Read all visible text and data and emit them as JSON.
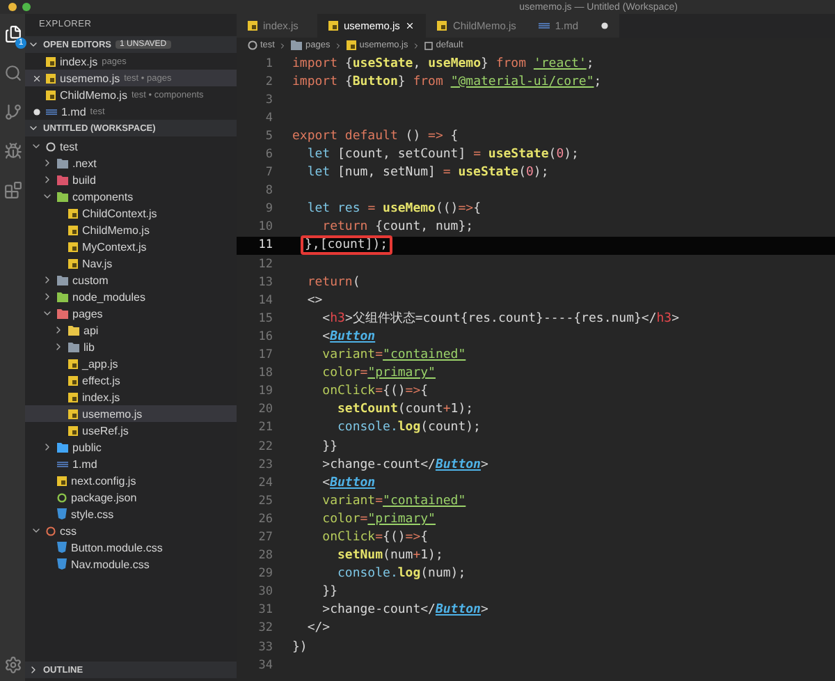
{
  "window": {
    "title": "usememo.js — Untitled (Workspace)"
  },
  "activity_bar": [
    {
      "kind": "explorer",
      "selected": true,
      "badge": "1"
    },
    {
      "kind": "search",
      "selected": false
    },
    {
      "kind": "source-control",
      "selected": false
    },
    {
      "kind": "debug",
      "selected": false
    },
    {
      "kind": "extensions",
      "selected": false
    },
    {
      "kind": "settings",
      "selected": false
    }
  ],
  "sidebar": {
    "title": "EXPLORER",
    "open_editors": {
      "title": "OPEN EDITORS",
      "badge": "1 UNSAVED",
      "expanded": true,
      "items": [
        {
          "name": "index.js",
          "description": "pages",
          "kind": "js",
          "selected": false,
          "modified": false
        },
        {
          "name": "usememo.js",
          "description": "test • pages",
          "kind": "js",
          "selected": true,
          "modified": false
        },
        {
          "name": "ChildMemo.js",
          "description": "test • components",
          "kind": "js",
          "selected": false,
          "modified": false
        },
        {
          "name": "1.md",
          "description": "test",
          "kind": "md",
          "selected": false,
          "modified": true
        }
      ]
    },
    "workspace": {
      "title": "UNTITLED (WORKSPACE)",
      "expanded": true,
      "tree": [
        {
          "name": "test",
          "kind": "root",
          "color": "#c8c8c8",
          "expanded": true,
          "children": [
            {
              "name": ".next",
              "kind": "folder",
              "color": "#8d9aa8",
              "expanded": false
            },
            {
              "name": "build",
              "kind": "folder",
              "color": "#d9536a",
              "expanded": false
            },
            {
              "name": "components",
              "kind": "folder",
              "color": "#8bc34a",
              "expanded": true,
              "children": [
                {
                  "name": "ChildContext.js",
                  "kind": "js",
                  "selected": false
                },
                {
                  "name": "ChildMemo.js",
                  "kind": "js",
                  "selected": false
                },
                {
                  "name": "MyContext.js",
                  "kind": "js",
                  "selected": false
                },
                {
                  "name": "Nav.js",
                  "kind": "js",
                  "selected": false
                }
              ]
            },
            {
              "name": "custom",
              "kind": "folder",
              "color": "#8d9aa8",
              "expanded": false
            },
            {
              "name": "node_modules",
              "kind": "folder",
              "color": "#8bc34a",
              "expanded": false
            },
            {
              "name": "pages",
              "kind": "folder",
              "color": "#e26a6a",
              "expanded": true,
              "children": [
                {
                  "name": "api",
                  "kind": "folder",
                  "color": "#e8c547",
                  "expanded": false
                },
                {
                  "name": "lib",
                  "kind": "folder",
                  "color": "#8d9aa8",
                  "expanded": false
                },
                {
                  "name": "_app.js",
                  "kind": "js",
                  "selected": false
                },
                {
                  "name": "effect.js",
                  "kind": "js",
                  "selected": false
                },
                {
                  "name": "index.js",
                  "kind": "js",
                  "selected": false
                },
                {
                  "name": "usememo.js",
                  "kind": "js",
                  "selected": true
                },
                {
                  "name": "useRef.js",
                  "kind": "js",
                  "selected": false
                }
              ]
            },
            {
              "name": "public",
              "kind": "folder",
              "color": "#42a5f5",
              "expanded": false
            },
            {
              "name": "1.md",
              "kind": "md",
              "selected": false
            },
            {
              "name": "next.config.js",
              "kind": "js",
              "selected": false
            },
            {
              "name": "package.json",
              "kind": "json",
              "selected": false
            },
            {
              "name": "style.css",
              "kind": "css",
              "selected": false
            }
          ]
        },
        {
          "name": "css",
          "kind": "root",
          "color": "#e07050",
          "expanded": true,
          "children": [
            {
              "name": "Button.module.css",
              "kind": "css",
              "selected": false
            },
            {
              "name": "Nav.module.css",
              "kind": "css",
              "selected": false
            }
          ]
        }
      ]
    },
    "outline": {
      "title": "OUTLINE",
      "expanded": false
    }
  },
  "tabs": [
    {
      "label": "index.js",
      "kind": "js",
      "selected": false,
      "modified": false
    },
    {
      "label": "usememo.js",
      "kind": "js",
      "selected": true,
      "modified": false
    },
    {
      "label": "ChildMemo.js",
      "kind": "js",
      "selected": false,
      "modified": false
    },
    {
      "label": "1.md",
      "kind": "md",
      "selected": false,
      "modified": true
    }
  ],
  "breadcrumb": [
    {
      "label": "test",
      "kind": "root"
    },
    {
      "label": "pages",
      "kind": "folder"
    },
    {
      "label": "usememo.js",
      "kind": "js"
    },
    {
      "label": "default",
      "kind": "symbol"
    }
  ],
  "code": [
    {
      "number": "1",
      "tokens": [
        {
          "kind": "kw",
          "text": "import "
        },
        {
          "kind": "plain",
          "text": "{"
        },
        {
          "kind": "fn",
          "text": "useState"
        },
        {
          "kind": "plain",
          "text": ", "
        },
        {
          "kind": "fn",
          "text": "useMemo"
        },
        {
          "kind": "plain",
          "text": "} "
        },
        {
          "kind": "kw",
          "text": "from "
        },
        {
          "kind": "str",
          "text": "'react'"
        },
        {
          "kind": "plain",
          "text": ";"
        }
      ]
    },
    {
      "number": "2",
      "tokens": [
        {
          "kind": "kw",
          "text": "import "
        },
        {
          "kind": "plain",
          "text": "{"
        },
        {
          "kind": "fn",
          "text": "Button"
        },
        {
          "kind": "plain",
          "text": "} "
        },
        {
          "kind": "kw",
          "text": "from "
        },
        {
          "kind": "str",
          "text": "\"@material-ui/core\""
        },
        {
          "kind": "plain",
          "text": ";"
        }
      ]
    },
    {
      "number": "3"
    },
    {
      "number": "4"
    },
    {
      "number": "5",
      "tokens": [
        {
          "kind": "kw",
          "text": "export default "
        },
        {
          "kind": "plain",
          "text": "() "
        },
        {
          "kind": "op",
          "text": "=>"
        },
        {
          "kind": "plain",
          "text": " {"
        }
      ]
    },
    {
      "number": "6",
      "tokens": [
        {
          "kind": "var",
          "text": "  let "
        },
        {
          "kind": "plain",
          "text": "[count, setCount] "
        },
        {
          "kind": "op",
          "text": "= "
        },
        {
          "kind": "fn",
          "text": "useState"
        },
        {
          "kind": "plain",
          "text": "("
        },
        {
          "kind": "num",
          "text": "0"
        },
        {
          "kind": "plain",
          "text": ");"
        }
      ]
    },
    {
      "number": "7",
      "tokens": [
        {
          "kind": "var",
          "text": "  let "
        },
        {
          "kind": "plain",
          "text": "[num, setNum] "
        },
        {
          "kind": "op",
          "text": "= "
        },
        {
          "kind": "fn",
          "text": "useState"
        },
        {
          "kind": "plain",
          "text": "("
        },
        {
          "kind": "num",
          "text": "0"
        },
        {
          "kind": "plain",
          "text": ");"
        }
      ]
    },
    {
      "number": "8"
    },
    {
      "number": "9",
      "tokens": [
        {
          "kind": "var",
          "text": "  let res "
        },
        {
          "kind": "op",
          "text": "= "
        },
        {
          "kind": "fn",
          "text": "useMemo"
        },
        {
          "kind": "plain",
          "text": "(()"
        },
        {
          "kind": "op",
          "text": "=>"
        },
        {
          "kind": "plain",
          "text": "{"
        }
      ]
    },
    {
      "number": "10",
      "tokens": [
        {
          "kind": "kw",
          "text": "    return "
        },
        {
          "kind": "plain",
          "text": "{count, num};"
        }
      ]
    },
    {
      "number": "11",
      "current": true,
      "annotated": true,
      "tokens": [
        {
          "kind": "plain",
          "text": "},[count]);"
        }
      ]
    },
    {
      "number": "12"
    },
    {
      "number": "13",
      "tokens": [
        {
          "kind": "kw",
          "text": "  return"
        },
        {
          "kind": "plain",
          "text": "("
        }
      ]
    },
    {
      "number": "14",
      "tokens": [
        {
          "kind": "plain",
          "text": "  <>"
        }
      ]
    },
    {
      "number": "15",
      "tokens": [
        {
          "kind": "plain",
          "text": "    <"
        },
        {
          "kind": "tag",
          "text": "h3"
        },
        {
          "kind": "plain",
          "text": ">父组件状态=count{res.count}----{res.num}</"
        },
        {
          "kind": "tag",
          "text": "h3"
        },
        {
          "kind": "plain",
          "text": ">"
        }
      ]
    },
    {
      "number": "16",
      "tokens": [
        {
          "kind": "plain",
          "text": "    <"
        },
        {
          "kind": "comp",
          "text": "Button"
        }
      ]
    },
    {
      "number": "17",
      "tokens": [
        {
          "kind": "attr",
          "text": "    variant"
        },
        {
          "kind": "op",
          "text": "="
        },
        {
          "kind": "str",
          "text": "\"contained\""
        }
      ]
    },
    {
      "number": "18",
      "tokens": [
        {
          "kind": "attr",
          "text": "    color"
        },
        {
          "kind": "op",
          "text": "="
        },
        {
          "kind": "str",
          "text": "\"primary\""
        }
      ]
    },
    {
      "number": "19",
      "tokens": [
        {
          "kind": "attr",
          "text": "    onClick"
        },
        {
          "kind": "op",
          "text": "="
        },
        {
          "kind": "plain",
          "text": "{()"
        },
        {
          "kind": "op",
          "text": "=>"
        },
        {
          "kind": "plain",
          "text": "{"
        }
      ]
    },
    {
      "number": "20",
      "tokens": [
        {
          "kind": "fn",
          "text": "      setCount"
        },
        {
          "kind": "plain",
          "text": "(count"
        },
        {
          "kind": "op",
          "text": "+"
        },
        {
          "kind": "plain",
          "text": "1);"
        }
      ]
    },
    {
      "number": "21",
      "tokens": [
        {
          "kind": "var",
          "text": "      console."
        },
        {
          "kind": "fn",
          "text": "log"
        },
        {
          "kind": "plain",
          "text": "(count);"
        }
      ]
    },
    {
      "number": "22",
      "tokens": [
        {
          "kind": "plain",
          "text": "    }}"
        }
      ]
    },
    {
      "number": "23",
      "tokens": [
        {
          "kind": "plain",
          "text": "    >change-count</"
        },
        {
          "kind": "comp",
          "text": "Button"
        },
        {
          "kind": "plain",
          "text": ">"
        }
      ]
    },
    {
      "number": "24",
      "tokens": [
        {
          "kind": "plain",
          "text": "    <"
        },
        {
          "kind": "comp",
          "text": "Button"
        }
      ]
    },
    {
      "number": "25",
      "tokens": [
        {
          "kind": "attr",
          "text": "    variant"
        },
        {
          "kind": "op",
          "text": "="
        },
        {
          "kind": "str",
          "text": "\"contained\""
        }
      ]
    },
    {
      "number": "26",
      "tokens": [
        {
          "kind": "attr",
          "text": "    color"
        },
        {
          "kind": "op",
          "text": "="
        },
        {
          "kind": "str",
          "text": "\"primary\""
        }
      ]
    },
    {
      "number": "27",
      "tokens": [
        {
          "kind": "attr",
          "text": "    onClick"
        },
        {
          "kind": "op",
          "text": "="
        },
        {
          "kind": "plain",
          "text": "{()"
        },
        {
          "kind": "op",
          "text": "=>"
        },
        {
          "kind": "plain",
          "text": "{"
        }
      ]
    },
    {
      "number": "28",
      "tokens": [
        {
          "kind": "fn",
          "text": "      setNum"
        },
        {
          "kind": "plain",
          "text": "(num"
        },
        {
          "kind": "op",
          "text": "+"
        },
        {
          "kind": "plain",
          "text": "1);"
        }
      ]
    },
    {
      "number": "29",
      "tokens": [
        {
          "kind": "var",
          "text": "      console."
        },
        {
          "kind": "fn",
          "text": "log"
        },
        {
          "kind": "plain",
          "text": "(num);"
        }
      ]
    },
    {
      "number": "30",
      "tokens": [
        {
          "kind": "plain",
          "text": "    }}"
        }
      ]
    },
    {
      "number": "31",
      "tokens": [
        {
          "kind": "plain",
          "text": "    >change-count</"
        },
        {
          "kind": "comp",
          "text": "Button"
        },
        {
          "kind": "plain",
          "text": ">"
        }
      ]
    },
    {
      "number": "32",
      "tokens": [
        {
          "kind": "plain",
          "text": "  </>"
        }
      ]
    },
    {
      "number": "33",
      "tokens": [
        {
          "kind": "plain",
          "text": "})"
        }
      ]
    },
    {
      "number": "34"
    }
  ]
}
